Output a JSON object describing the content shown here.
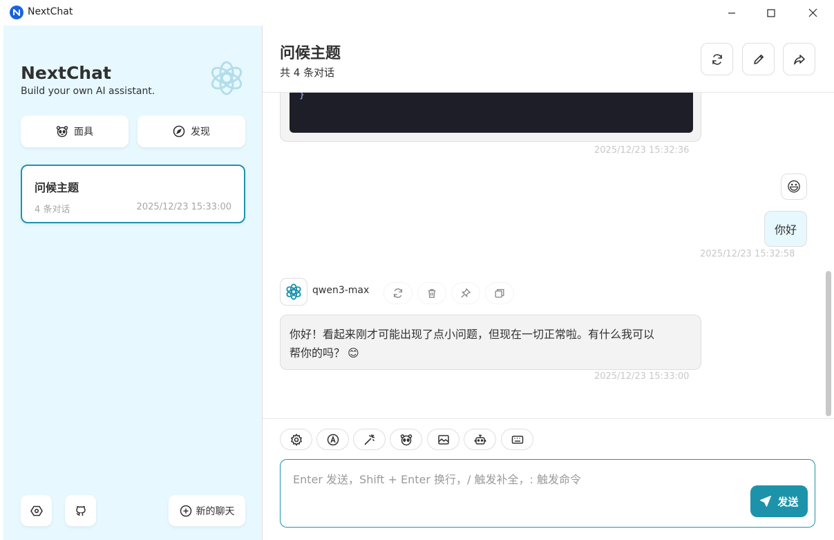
{
  "window": {
    "title": "NextChat",
    "icons": {
      "app": "nextchat-logo-icon",
      "minimize": "minimize-icon",
      "maximize": "maximize-icon",
      "close": "close-icon"
    }
  },
  "sidebar": {
    "brand_title": "NextChat",
    "brand_subtitle": "Build your own AI assistant.",
    "mask_button": "面具",
    "discover_button": "发现",
    "chat_list": [
      {
        "title": "问候主题",
        "count": "4 条对话",
        "time": "2025/12/23 15:33:00",
        "selected": true
      }
    ],
    "new_chat_button": "新的聊天",
    "accent_color": "#1d93ab",
    "background_color": "#e7f8ff"
  },
  "header": {
    "title": "问候主题",
    "subtitle": "共 4 条对话",
    "icons": [
      "reload-icon",
      "edit-icon",
      "share-icon"
    ]
  },
  "messages": {
    "code_tail": [
      "}",
      "}"
    ],
    "code_time": "2025/12/23 15:32:36",
    "user_avatar": "😃",
    "user_text": "你好",
    "user_time": "2025/12/23 15:32:58",
    "model_name": "qwen3-max",
    "actions": [
      "retry-icon",
      "delete-icon",
      "pin-icon",
      "copy-icon"
    ],
    "bot_text_line1": "你好！看起来刚才可能出现了点小问题，但现在一切正常啦。有什么我可以",
    "bot_text_line2": "帮你的吗？",
    "bot_emoji": "😊",
    "bot_time": "2025/12/23 15:33:00"
  },
  "composer": {
    "tools": [
      "settings-icon",
      "translate-icon",
      "magic-wand-icon",
      "mask-icon",
      "image-icon",
      "robot-icon",
      "keyboard-icon"
    ],
    "placeholder": "Enter 发送，Shift + Enter 换行，/ 触发补全，: 触发命令",
    "value": "",
    "send_label": "发送"
  }
}
